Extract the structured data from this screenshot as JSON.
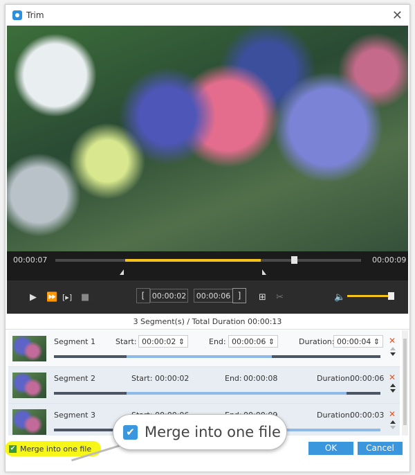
{
  "window": {
    "title": "Trim",
    "app_icon": "film-icon"
  },
  "timeline": {
    "left_time": "00:00:07",
    "right_time": "00:00:09",
    "selection_start_pct": 23,
    "selection_end_pct": 67,
    "playhead_pct": 78
  },
  "controls": {
    "start_time": "00:00:02",
    "end_time": "00:00:06",
    "start_bracket": "[",
    "end_bracket": "]",
    "volume_pct": 100
  },
  "summary": "3 Segment(s) / Total Duration 00:00:13",
  "labels": {
    "start": "Start:",
    "end": "End:",
    "duration": "Duration:"
  },
  "segments": [
    {
      "name": "Segment 1",
      "start": "00:00:02",
      "end": "00:00:06",
      "duration": "00:00:04",
      "editable": true
    },
    {
      "name": "Segment 2",
      "start": "00:00:02",
      "end": "00:00:08",
      "duration": "00:00:06",
      "editable": false
    },
    {
      "name": "Segment 3",
      "start": "00:00:06",
      "end": "00:00:09",
      "duration": "00:00:03",
      "editable": false
    }
  ],
  "footer": {
    "merge_label": "Merge into one file",
    "merge_checked": true,
    "ok": "OK",
    "cancel": "Cancel"
  },
  "callout": {
    "label": "Merge into one file"
  },
  "colors": {
    "accent": "#3a96dd",
    "selection": "#f5c31c",
    "highlight": "#f6f619",
    "delete": "#e8531d"
  }
}
